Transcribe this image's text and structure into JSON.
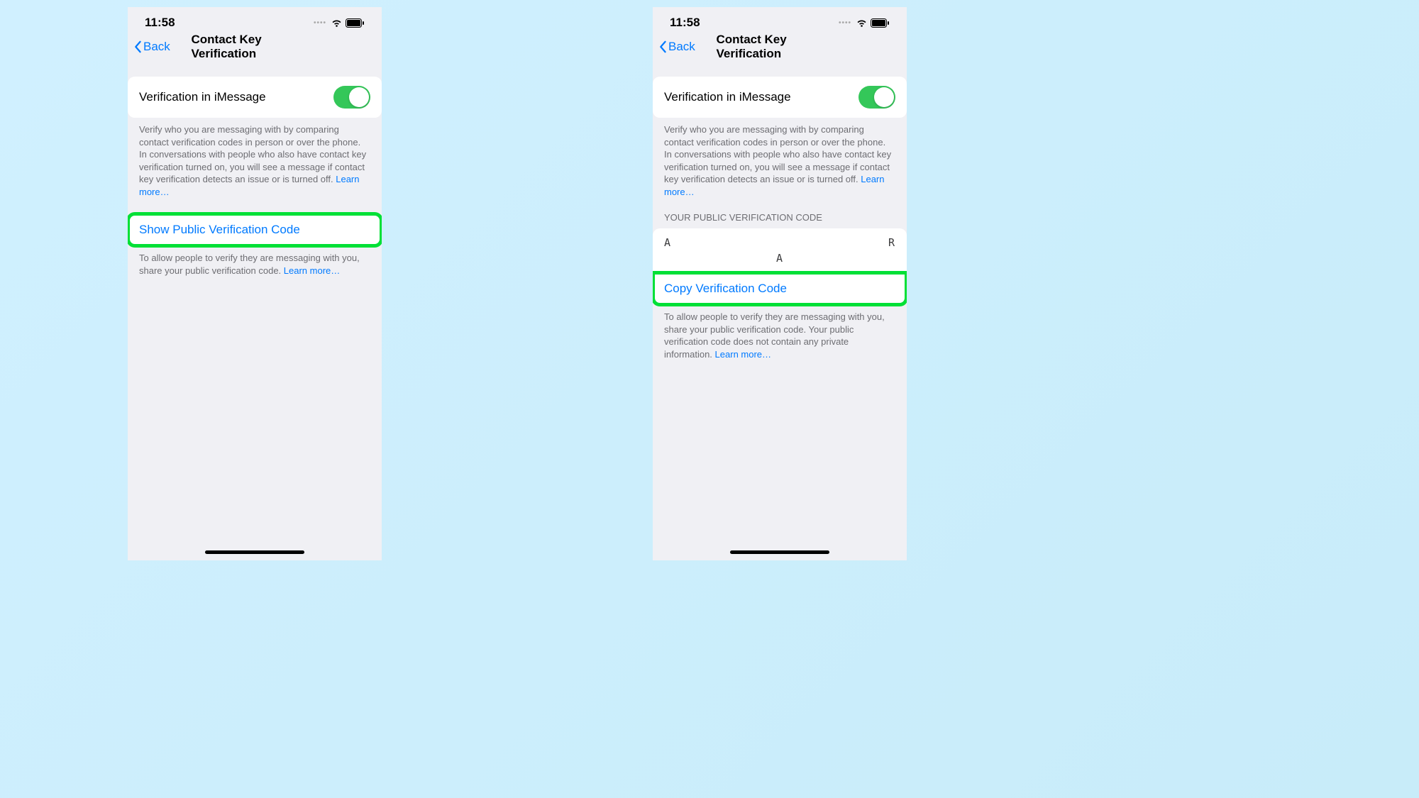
{
  "status": {
    "time": "11:58"
  },
  "nav": {
    "back": "Back",
    "title": "Contact Key Verification"
  },
  "toggle_label": "Verification in iMessage",
  "description": "Verify who you are messaging with by comparing contact verification codes in person or over the phone. In conversations with people who also have contact key verification turned on, you will see a message if contact key verification detects an issue or is turned off. ",
  "learn_more": "Learn more…",
  "left": {
    "show_button": "Show Public Verification Code",
    "footer": "To allow people to verify they are messaging with you, share your public verification code. "
  },
  "right": {
    "header": "YOUR PUBLIC VERIFICATION CODE",
    "code_left": "A",
    "code_right": "R",
    "code_bottom": "A",
    "copy_button": "Copy Verification Code",
    "footer": "To allow people to verify they are messaging with you, share your public verification code. Your public verification code does not contain any private information. "
  }
}
